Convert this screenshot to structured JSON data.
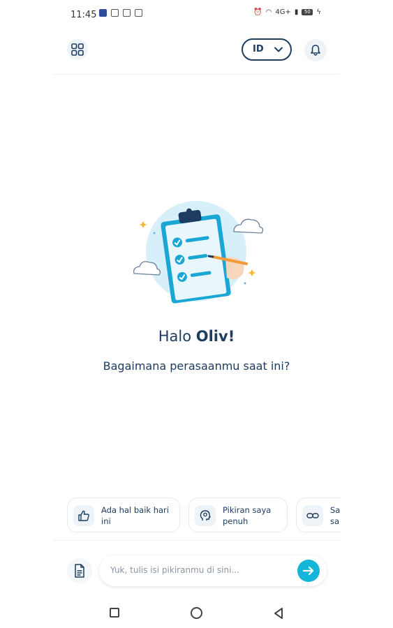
{
  "status_bar": {
    "time": "11:45",
    "network": "4G+",
    "battery": "50"
  },
  "header": {
    "menu_icon": "grid-icon",
    "language": "ID",
    "language_icon": "chevron-down-icon",
    "notification_icon": "bell-icon"
  },
  "main": {
    "greeting_prefix": "Halo ",
    "user_name": "Oliv!",
    "question": "Bagaimana perasaanmu saat ini?"
  },
  "suggestions": [
    {
      "icon": "thumbs-up-icon",
      "line1": "Ada hal baik hari",
      "line2": "ini"
    },
    {
      "icon": "head-mind-icon",
      "line1": "Pikiran saya",
      "line2": "penuh"
    },
    {
      "icon": "link-icon",
      "line1": "Sa",
      "line2": "sa"
    }
  ],
  "composer": {
    "placeholder": "Yuk, tulis isi pikiranmu di sini...",
    "attach_icon": "document-icon",
    "send_icon": "arrow-right-icon"
  },
  "colors": {
    "primary": "#1d3c60",
    "accent": "#13b5d8",
    "chip_icon_bg": "#eef3f8"
  }
}
